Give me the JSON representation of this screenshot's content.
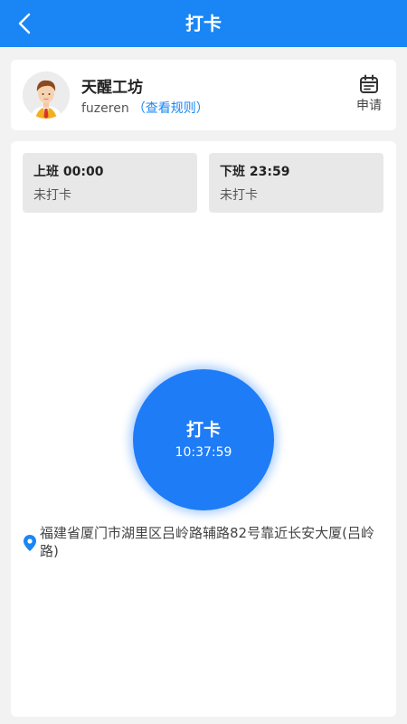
{
  "header": {
    "title": "打卡",
    "back_icon": "chevron-left-icon",
    "background": "#1a86f5"
  },
  "profile": {
    "company": "天醒工坊",
    "username": "fuzeren",
    "rules_link": "（查看规则）",
    "apply_label": "申请",
    "apply_icon": "calendar-icon",
    "avatar_icon": "user-avatar"
  },
  "shifts": [
    {
      "time": "上班 00:00",
      "status": "未打卡"
    },
    {
      "time": "下班 23:59",
      "status": "未打卡"
    }
  ],
  "punch": {
    "label": "打卡",
    "time": "10:37:59",
    "color": "#1e7cf7"
  },
  "location": {
    "icon": "location-pin-icon",
    "address": "福建省厦门市湖里区吕岭路辅路82号靠近长安大厦(吕岭路)"
  }
}
